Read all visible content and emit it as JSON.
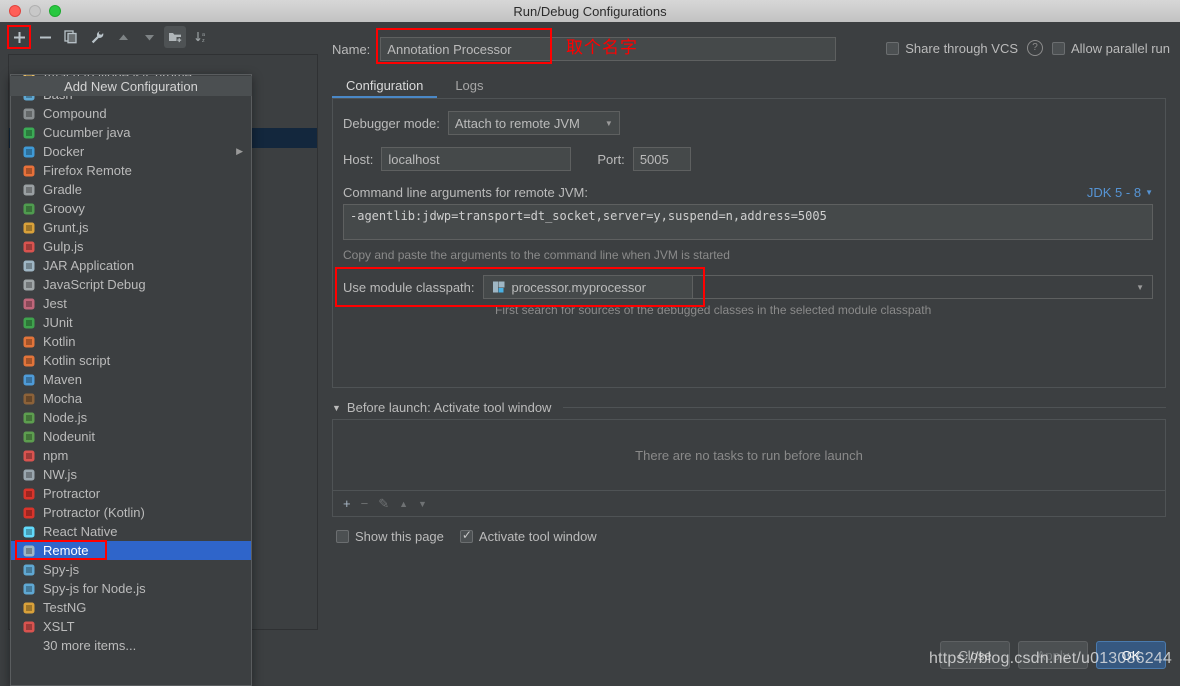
{
  "window": {
    "title": "Run/Debug Configurations",
    "traffic_lights": [
      "close-red",
      "minimize-gray",
      "zoom-green"
    ]
  },
  "toolbar": {
    "buttons": [
      {
        "name": "add",
        "glyph": "+",
        "highlighted": true
      },
      {
        "name": "remove",
        "glyph": "−",
        "highlighted": false
      },
      {
        "name": "copy",
        "glyph": "⧉",
        "highlighted": false
      },
      {
        "name": "edit-templates",
        "glyph": "🔧",
        "highlighted": false
      },
      {
        "name": "move-up",
        "glyph": "▲",
        "highlighted": false
      },
      {
        "name": "move-down",
        "glyph": "▼",
        "highlighted": false
      },
      {
        "name": "new-folder",
        "glyph": "🗂",
        "highlighted": false
      },
      {
        "name": "sort-alphabetically",
        "glyph": "↓",
        "highlighted": false
      }
    ]
  },
  "popup": {
    "tooltip": "Add New Configuration",
    "items": [
      {
        "label": "Attach to Node.js/Chrome",
        "icon": "nodejs-chrome-icon",
        "icon_color": "#e8bf6a",
        "selected": false,
        "submenu": false
      },
      {
        "label": "Bash",
        "icon": "terminal-icon",
        "icon_color": "#5fa8d3",
        "selected": false,
        "submenu": false
      },
      {
        "label": "Compound",
        "icon": "compound-icon",
        "icon_color": "#8a8f91",
        "selected": false,
        "submenu": false
      },
      {
        "label": "Cucumber java",
        "icon": "cucumber-icon",
        "icon_color": "#3bab55",
        "selected": false,
        "submenu": false
      },
      {
        "label": "Docker",
        "icon": "docker-icon",
        "icon_color": "#3f9ad6",
        "selected": false,
        "submenu": true
      },
      {
        "label": "Firefox Remote",
        "icon": "firefox-icon",
        "icon_color": "#e8713a",
        "selected": false,
        "submenu": false
      },
      {
        "label": "Gradle",
        "icon": "gradle-icon",
        "icon_color": "#9aa0a3",
        "selected": false,
        "submenu": false
      },
      {
        "label": "Groovy",
        "icon": "groovy-icon",
        "icon_color": "#4f9c4f",
        "selected": false,
        "submenu": false
      },
      {
        "label": "Grunt.js",
        "icon": "grunt-icon",
        "icon_color": "#d9a13a",
        "selected": false,
        "submenu": false
      },
      {
        "label": "Gulp.js",
        "icon": "gulp-icon",
        "icon_color": "#d9534f",
        "selected": false,
        "submenu": false
      },
      {
        "label": "JAR Application",
        "icon": "jar-icon",
        "icon_color": "#9fb6c4",
        "selected": false,
        "submenu": false
      },
      {
        "label": "JavaScript Debug",
        "icon": "javascript-debug-icon",
        "icon_color": "#a0a6a8",
        "selected": false,
        "submenu": false
      },
      {
        "label": "Jest",
        "icon": "jest-icon",
        "icon_color": "#c0667a",
        "selected": false,
        "submenu": false
      },
      {
        "label": "JUnit",
        "icon": "junit-icon",
        "icon_color": "#3fa34d",
        "selected": false,
        "submenu": false
      },
      {
        "label": "Kotlin",
        "icon": "kotlin-icon",
        "icon_color": "#e2743a",
        "selected": false,
        "submenu": false
      },
      {
        "label": "Kotlin script",
        "icon": "kotlin-script-icon",
        "icon_color": "#e2743a",
        "selected": false,
        "submenu": false
      },
      {
        "label": "Maven",
        "icon": "maven-icon",
        "icon_color": "#4e9bd8",
        "selected": false,
        "submenu": false
      },
      {
        "label": "Mocha",
        "icon": "mocha-icon",
        "icon_color": "#8c6239",
        "selected": false,
        "submenu": false
      },
      {
        "label": "Node.js",
        "icon": "nodejs-icon",
        "icon_color": "#5d9e4f",
        "selected": false,
        "submenu": false
      },
      {
        "label": "Nodeunit",
        "icon": "nodeunit-icon",
        "icon_color": "#5d9e4f",
        "selected": false,
        "submenu": false
      },
      {
        "label": "npm",
        "icon": "npm-icon",
        "icon_color": "#d9534f",
        "selected": false,
        "submenu": false
      },
      {
        "label": "NW.js",
        "icon": "nwjs-icon",
        "icon_color": "#9aa6ae",
        "selected": false,
        "submenu": false
      },
      {
        "label": "Protractor",
        "icon": "protractor-icon",
        "icon_color": "#d9342b",
        "selected": false,
        "submenu": false
      },
      {
        "label": "Protractor (Kotlin)",
        "icon": "protractor-kotlin-icon",
        "icon_color": "#d9342b",
        "selected": false,
        "submenu": false
      },
      {
        "label": "React Native",
        "icon": "react-native-icon",
        "icon_color": "#61dafb",
        "selected": false,
        "submenu": false
      },
      {
        "label": "Remote",
        "icon": "remote-icon",
        "icon_color": "#9fb6c4",
        "selected": true,
        "submenu": false
      },
      {
        "label": "Spy-js",
        "icon": "spyjs-icon",
        "icon_color": "#5fa8d3",
        "selected": false,
        "submenu": false
      },
      {
        "label": "Spy-js for Node.js",
        "icon": "spyjs-node-icon",
        "icon_color": "#5fa8d3",
        "selected": false,
        "submenu": false
      },
      {
        "label": "TestNG",
        "icon": "testng-icon",
        "icon_color": "#d9a13a",
        "selected": false,
        "submenu": false
      },
      {
        "label": "XSLT",
        "icon": "xslt-icon",
        "icon_color": "#d9534f",
        "selected": false,
        "submenu": false
      },
      {
        "label": "30 more items...",
        "icon": "",
        "icon_color": "",
        "selected": false,
        "submenu": false
      }
    ]
  },
  "form": {
    "name_label": "Name:",
    "name_value": "Annotation Processor",
    "name_annotation_cn": "取个名字",
    "share_vcs_label": "Share through VCS",
    "share_vcs_checked": false,
    "help_glyph": "?",
    "allow_parallel_label": "Allow parallel run",
    "allow_parallel_checked": false,
    "tabs": [
      {
        "label": "Configuration",
        "active": true
      },
      {
        "label": "Logs",
        "active": false
      }
    ],
    "debugger_mode_label": "Debugger mode:",
    "debugger_mode_value": "Attach to remote JVM",
    "host_label": "Host:",
    "host_value": "localhost",
    "port_label": "Port:",
    "port_value": "5005",
    "cmd_label": "Command line arguments for remote JVM:",
    "jdk_selector": "JDK 5 - 8",
    "cmd_value": "-agentlib:jdwp=transport=dt_socket,server=y,suspend=n,address=5005",
    "cmd_hint": "Copy and paste the arguments to the command line when JVM is started",
    "module_classpath_label": "Use module classpath:",
    "module_classpath_value": "processor.myprocessor",
    "module_classpath_hint": "First search for sources of the debugged classes in the selected module classpath",
    "before_launch_title": "Before launch: Activate tool window",
    "before_launch_empty": "There are no tasks to run before launch",
    "before_launch_toolbar": [
      "+",
      "−",
      "✎",
      "▲",
      "▼"
    ],
    "show_page_label": "Show this page",
    "show_page_checked": false,
    "activate_tool_window_label": "Activate tool window",
    "activate_tool_window_checked": true
  },
  "footer": {
    "close_label": "Close",
    "apply_label": "Apply",
    "ok_label": "OK",
    "watermark": "https://blog.csdn.net/u013086244"
  },
  "colors": {
    "accent_blue": "#2f65ca",
    "tab_underline": "#4a88c7",
    "link_blue": "#5694d4",
    "annotation_red": "#ff0000",
    "panel_bg": "#3c3f41",
    "field_bg": "#45494a",
    "primary_button": "#365880"
  }
}
